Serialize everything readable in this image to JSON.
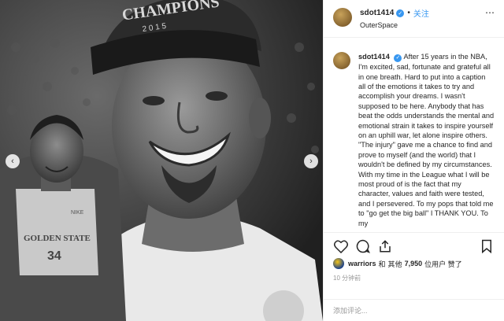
{
  "post": {
    "username": "sdot1414",
    "follow_label": "关注",
    "location": "OuterSpace",
    "caption": "After 15 years in the NBA, I'm excited, sad, fortunate and grateful all in one breath. Hard to put into a caption all of the emotions it takes to try and accomplish your dreams. I wasn't supposed to be here. Anybody that has beat the odds understands the mental and emotional strain it takes to inspire yourself on an uphill war, let alone inspire others. \"The injury\" gave me a chance to find and prove to myself (and the world) that I wouldn't be defined by my circumstances. With my time in the League what I will be most proud of is the fact that my character, values and faith were tested, and I persevered. To my pops that told me to \"go get the big ball\" I THANK YOU. To my",
    "likes": {
      "liker": "warriors",
      "and": "和",
      "others_prefix": "其他",
      "count": "7,950",
      "suffix": "位用户 赞了"
    },
    "time_ago": "10 分钟前",
    "comment_placeholder": "添加评论..."
  },
  "photo": {
    "cap_text": "CHAMPIONS",
    "cap_year": "2 0 1 5",
    "jersey_team": "GOLDEN STATE",
    "jersey_number": "34",
    "jersey_brand": "NIKE"
  },
  "icons": {
    "heart": "heart-icon",
    "comment": "comment-icon",
    "share": "share-icon",
    "save": "bookmark-icon"
  },
  "colors": {
    "accent": "#3897f0",
    "text": "#262626",
    "muted": "#999999"
  }
}
